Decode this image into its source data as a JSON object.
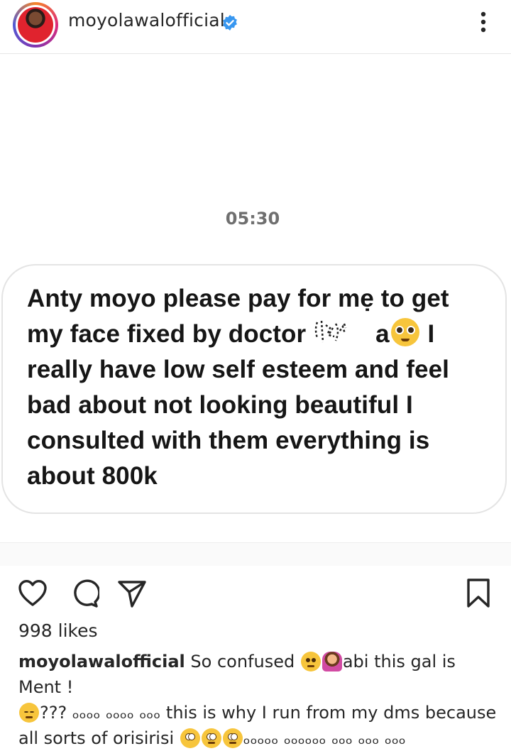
{
  "header": {
    "username": "moyolawalofficial",
    "verified": true,
    "verified_color": "#3897f0",
    "avatar_ring_colors": [
      "#f58529",
      "#dd2a7b",
      "#8134af",
      "#515bd4"
    ]
  },
  "post": {
    "timestamp": "05:30",
    "message_part1": "Anty moyo please pay for mẹ to get my face fixed by doctor ",
    "redacted_name_visible": "a",
    "message_part2": " I really have low self esteem and feel bad about not looking beautiful I consulted with them everything is about 800k",
    "inline_emoji": "pleading-face-icon"
  },
  "actions": {
    "like_icon": "heart-icon",
    "comment_icon": "comment-icon",
    "share_icon": "send-icon",
    "save_icon": "bookmark-icon"
  },
  "likes": "998 likes",
  "caption": {
    "username": "moyolawalofficial",
    "text1": " So confused ",
    "text2": "abi this gal is Ment !",
    "text3": "??? ₒₒₒₒ ₒₒₒₒ ₒₒₒ this is why I run from my dms because all sorts of orisirisi ",
    "text4": "ₒₒₒₒₒ ₒₒₒₒₒₒ ₒₒₒ ₒₒₒ ₒₒₒ"
  }
}
